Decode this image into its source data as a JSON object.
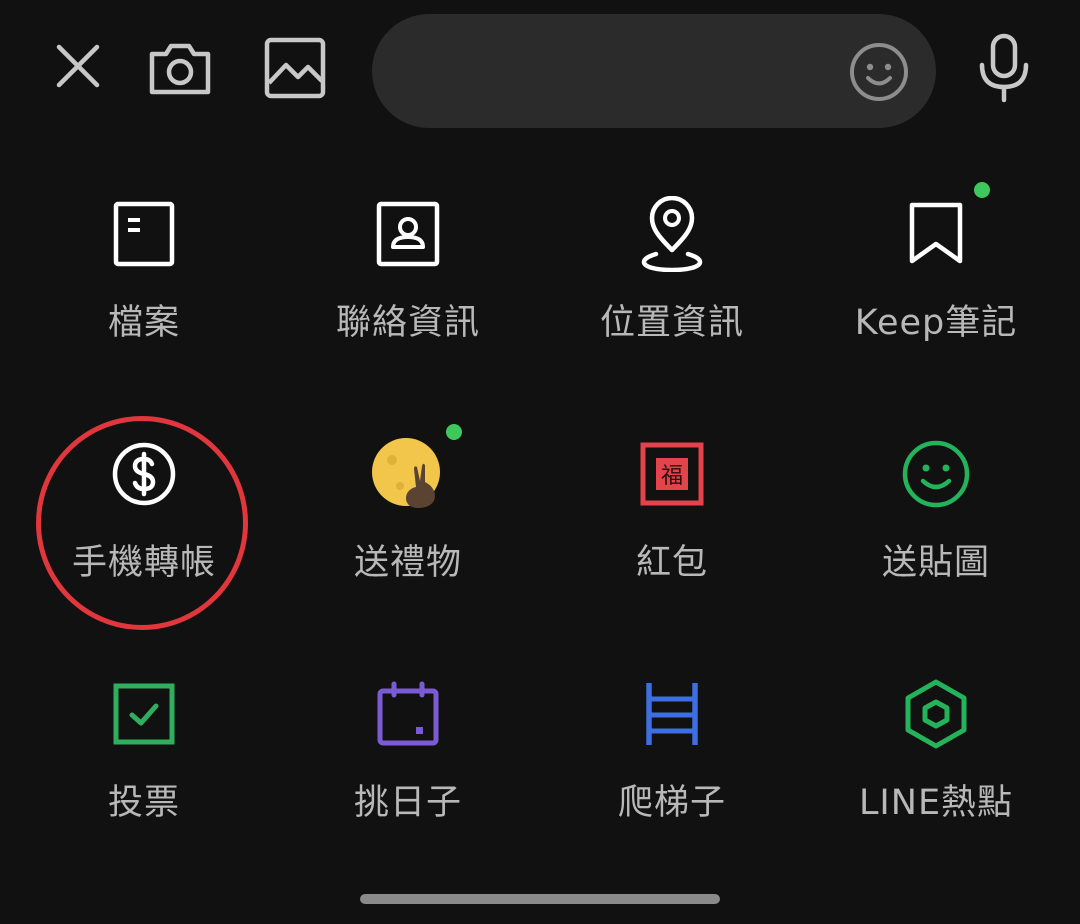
{
  "topbar": {
    "message_input_value": ""
  },
  "colors": {
    "background": "#111111",
    "input_background": "#2b2b2b",
    "icon_white": "#ffffff",
    "icon_grey": "#c8c8c8",
    "label_grey": "#b8b8b8",
    "new_dot": "#3cc85c",
    "highlight_ring": "#e0363c",
    "vote_green": "#2fae5e",
    "calendar_purple": "#7a5bd3",
    "ladder_blue": "#3d6fe0",
    "hotspot_green": "#24b35a",
    "red_packet_red": "#e4434b"
  },
  "menu": {
    "items": [
      {
        "label": "檔案",
        "icon": "file-icon"
      },
      {
        "label": "聯絡資訊",
        "icon": "contact-card-icon"
      },
      {
        "label": "位置資訊",
        "icon": "location-pin-icon"
      },
      {
        "label": "Keep筆記",
        "icon": "bookmark-icon",
        "new": true
      },
      {
        "label": "手機轉帳",
        "icon": "dollar-coin-icon",
        "highlighted": true
      },
      {
        "label": "送禮物",
        "icon": "moon-rabbit-icon",
        "new": true
      },
      {
        "label": "紅包",
        "icon": "red-packet-icon",
        "icon_text": "福"
      },
      {
        "label": "送貼圖",
        "icon": "sticker-smile-icon"
      },
      {
        "label": "投票",
        "icon": "vote-checkbox-icon"
      },
      {
        "label": "挑日子",
        "icon": "calendar-icon"
      },
      {
        "label": "爬梯子",
        "icon": "ladder-icon"
      },
      {
        "label": "LINE熱點",
        "icon": "hexagon-hotspot-icon"
      }
    ]
  }
}
